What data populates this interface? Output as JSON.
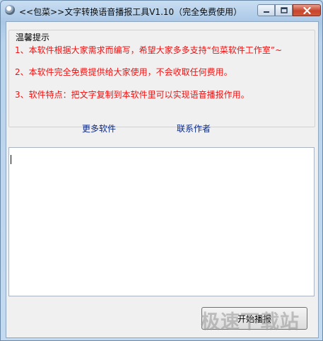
{
  "window": {
    "title": "<<包菜>>文字转换语音播报工具V1.10（完全免费使用）"
  },
  "tips": {
    "title": "温馨提示",
    "lines": [
      "1、本软件根据大家需求而编写，希望大家多多支持“包菜软件工作室”~",
      "2、本软件完全免费提供给大家使用，不会收取任何费用。",
      "3、软件特点：把文字复制到本软件里可以实现语音播报作用。"
    ]
  },
  "links": {
    "more_software": "更多软件",
    "contact_author": "联系作者"
  },
  "editor": {
    "value": ""
  },
  "actions": {
    "start_label": "开始播报"
  },
  "watermark": {
    "text": "极速下载站"
  },
  "colors": {
    "tip_text": "#ee1111",
    "link_text": "#0b2a8a"
  }
}
